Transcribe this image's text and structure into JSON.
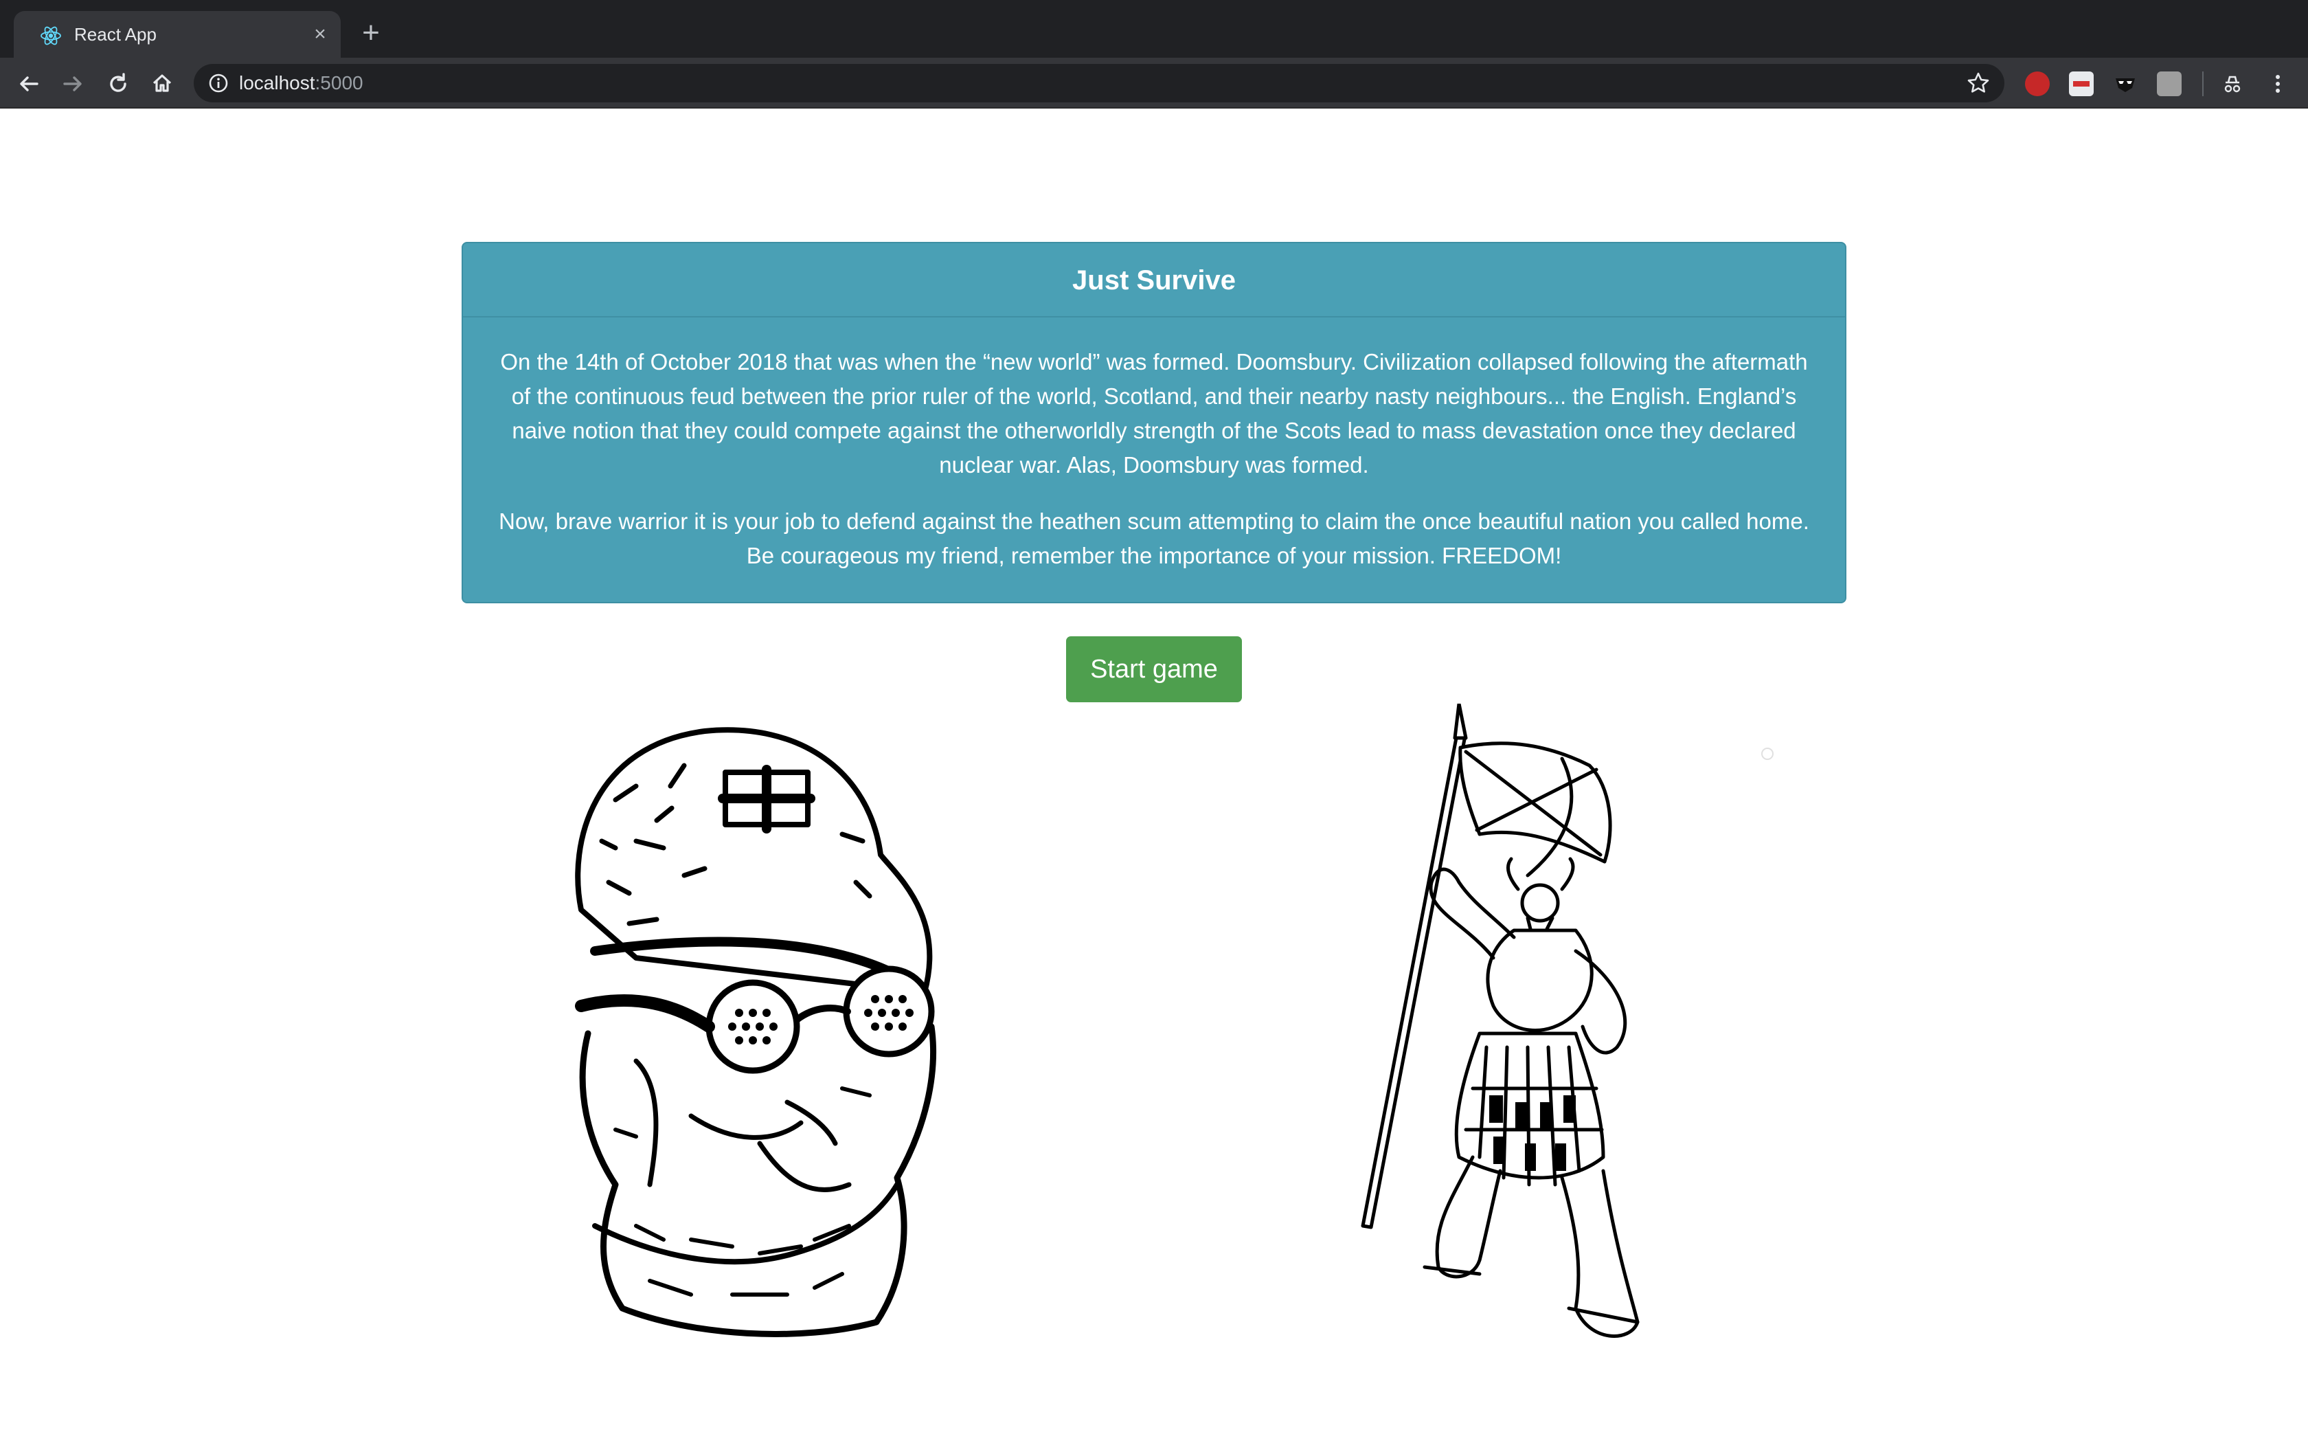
{
  "browser": {
    "tab_title": "React App",
    "tab_close": "×",
    "new_tab": "+",
    "url_host": "localhost",
    "url_port": ":5000",
    "icons": [
      "back-arrow-icon",
      "forward-arrow-icon",
      "reload-icon",
      "home-icon",
      "info-icon",
      "star-icon",
      "menu-icon"
    ]
  },
  "card": {
    "title": "Just Survive",
    "paragraph1": "On the 14th of October 2018 that was when the “new world” was formed. Doomsbury. Civilization collapsed following the aftermath of the continuous feud between the prior ruler of the world, Scotland, and their nearby nasty neighbours... the English. England’s naive notion that they could compete against the otherworldly strength of the Scots lead to mass devastation once they declared nuclear war. Alas, Doomsbury was formed.",
    "paragraph2": "Now, brave warrior it is your job to defend against the heathen scum attempting to claim the once beautiful nation you called home. Be courageous my friend, remember the importance of your mission. FREEDOM!"
  },
  "start_button": {
    "label": "Start game"
  },
  "colors": {
    "card_bg": "#4aa0b5",
    "button_bg": "#4e9f4e",
    "chrome_dark": "#202124",
    "chrome_toolbar": "#35363a"
  }
}
